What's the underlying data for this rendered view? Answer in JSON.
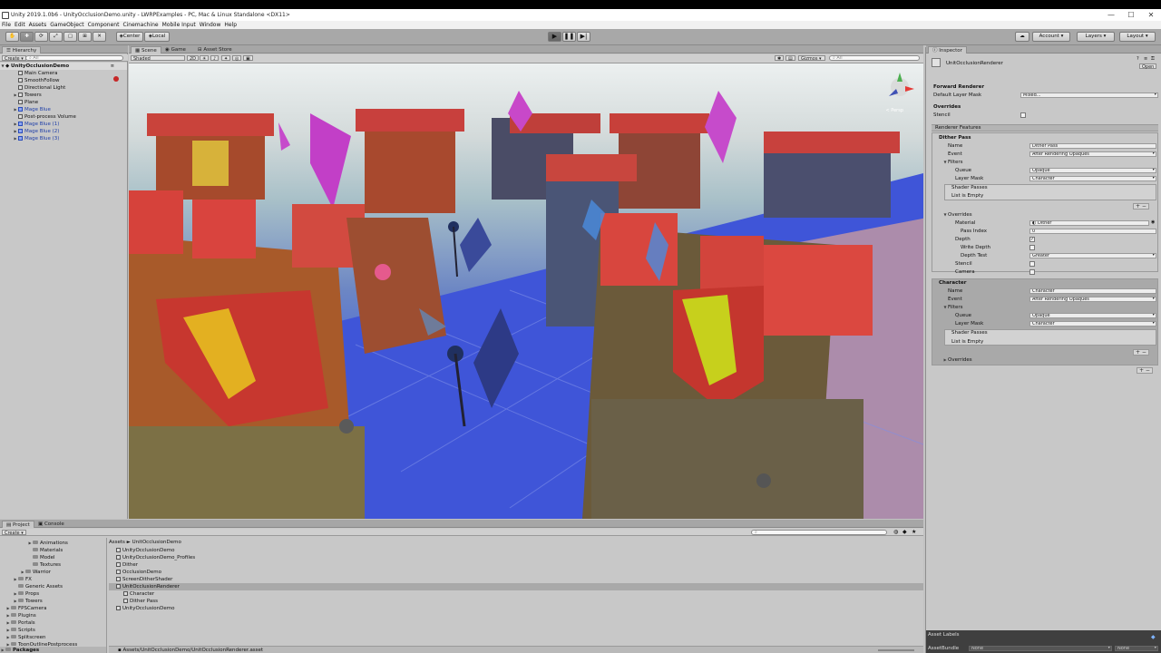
{
  "window": {
    "title": "Unity 2019.1.0b6 - UnityOcclusionDemo.unity - LWRPExamples - PC, Mac & Linux Standalone <DX11>",
    "controls": [
      "—",
      "☐",
      "✕"
    ]
  },
  "menu": [
    "File",
    "Edit",
    "Assets",
    "GameObject",
    "Component",
    "Cinemachine",
    "Mobile Input",
    "Window",
    "Help"
  ],
  "toolbar": {
    "pivot": "Center",
    "space": "Local",
    "account": "Account",
    "layers": "Layers",
    "layout": "Layout"
  },
  "hierarchy": {
    "tab": "Hierarchy",
    "create": "Create",
    "search_placeholder": "All",
    "scene": "UnityOcclusionDemo",
    "items": [
      {
        "label": "Main Camera",
        "blue": false,
        "arrow": ""
      },
      {
        "label": "SmoothFollow",
        "blue": false,
        "arrow": ""
      },
      {
        "label": "Directional Light",
        "blue": false,
        "arrow": ""
      },
      {
        "label": "Towers",
        "blue": false,
        "arrow": "▶"
      },
      {
        "label": "Plane",
        "blue": false,
        "arrow": ""
      },
      {
        "label": "Mage Blue",
        "blue": true,
        "arrow": "▶"
      },
      {
        "label": "Post-process Volume",
        "blue": false,
        "arrow": ""
      },
      {
        "label": "Mage Blue (1)",
        "blue": true,
        "arrow": "▶"
      },
      {
        "label": "Mage Blue (2)",
        "blue": true,
        "arrow": "▶"
      },
      {
        "label": "Mage Blue (3)",
        "blue": true,
        "arrow": "▶"
      }
    ]
  },
  "scene_view": {
    "tabs": [
      "Scene",
      "Game",
      "Asset Store"
    ],
    "shading": "Shaded",
    "mode_2d": "2D",
    "gizmos": "Gizmos",
    "search_placeholder": "All",
    "persp_label": "< Persp"
  },
  "inspector": {
    "tab": "Inspector",
    "asset_name": "UnitOcclusionRenderer",
    "open_button": "Open",
    "forward_renderer": "Forward Renderer",
    "default_layer_mask_label": "Default Layer Mask",
    "default_layer_mask_value": "Mixed...",
    "overrides_label": "Overrides",
    "stencil_label": "Stencil",
    "renderer_features": "Renderer Features",
    "dither": {
      "header": "Dither Pass",
      "name_label": "Name",
      "name_value": "Dither Pass",
      "event_label": "Event",
      "event_value": "After Rendering Opaques",
      "filters_label": "Filters",
      "queue_label": "Queue",
      "queue_value": "Opaque",
      "layer_mask_label": "Layer Mask",
      "layer_mask_value": "Character",
      "shader_passes": "Shader Passes",
      "list_empty": "List is Empty",
      "overrides_label": "Overrides",
      "material_label": "Material",
      "material_value": "Dither",
      "pass_index_label": "Pass Index",
      "pass_index_value": "0",
      "depth_label": "Depth",
      "write_depth_label": "Write Depth",
      "depth_test_label": "Depth Test",
      "depth_test_value": "Greater",
      "stencil_label": "Stencil",
      "camera_label": "Camera"
    },
    "character": {
      "header": "Character",
      "name_label": "Name",
      "name_value": "Character",
      "event_label": "Event",
      "event_value": "After Rendering Opaques",
      "filters_label": "Filters",
      "queue_label": "Queue",
      "queue_value": "Opaque",
      "layer_mask_label": "Layer Mask",
      "layer_mask_value": "Character",
      "shader_passes": "Shader Passes",
      "list_empty": "List is Empty",
      "overrides_label": "Overrides"
    },
    "asset_labels": "Asset Labels",
    "asset_bundle_label": "AssetBundle",
    "asset_bundle_value": "None",
    "asset_bundle_variant": "None"
  },
  "project": {
    "tabs": [
      "Project",
      "Console"
    ],
    "create": "Create",
    "tree": [
      {
        "label": "Animations",
        "indent": 3,
        "arrow": "▶"
      },
      {
        "label": "Materials",
        "indent": 3,
        "arrow": ""
      },
      {
        "label": "Model",
        "indent": 3,
        "arrow": ""
      },
      {
        "label": "Textures",
        "indent": 3,
        "arrow": ""
      },
      {
        "label": "Warrior",
        "indent": 2,
        "arrow": "▶"
      },
      {
        "label": "FX",
        "indent": 1,
        "arrow": "▶"
      },
      {
        "label": "Generic Assets",
        "indent": 1,
        "arrow": ""
      },
      {
        "label": "Props",
        "indent": 1,
        "arrow": "▶"
      },
      {
        "label": "Towers",
        "indent": 1,
        "arrow": "▶"
      },
      {
        "label": "FPSCamera",
        "indent": 0,
        "arrow": "▶"
      },
      {
        "label": "Plugins",
        "indent": 0,
        "arrow": "▶"
      },
      {
        "label": "Portals",
        "indent": 0,
        "arrow": "▶"
      },
      {
        "label": "Scripts",
        "indent": 0,
        "arrow": "▶"
      },
      {
        "label": "Splitscreen",
        "indent": 0,
        "arrow": "▶"
      },
      {
        "label": "ToonOutlinePostprocess",
        "indent": 0,
        "arrow": "▶"
      },
      {
        "label": "UnitOcclusionDemo",
        "indent": 0,
        "arrow": "",
        "selected": true
      }
    ],
    "packages": "Packages",
    "breadcrumb_root": "Assets",
    "breadcrumb_sep": "►",
    "breadcrumb_leaf": "UnitOcclusionDemo",
    "files": [
      {
        "label": "UnityOcclusionDemo",
        "indent": 0,
        "selected": false
      },
      {
        "label": "UnityOcclusionDemo_Profiles",
        "indent": 0,
        "selected": false
      },
      {
        "label": "Dither",
        "indent": 0,
        "selected": false
      },
      {
        "label": "OcclusionDemo",
        "indent": 0,
        "selected": false
      },
      {
        "label": "ScreenDitherShader",
        "indent": 0,
        "selected": false
      },
      {
        "label": "UnitOcclusionRenderer",
        "indent": 0,
        "selected": true
      },
      {
        "label": "Character",
        "indent": 1,
        "selected": false
      },
      {
        "label": "Dither Pass",
        "indent": 1,
        "selected": false
      },
      {
        "label": "UnityOcclusionDemo",
        "indent": 0,
        "selected": false
      }
    ],
    "status_path": "Assets/UnitOcclusionDemo/UnitOcclusionRenderer.asset"
  }
}
